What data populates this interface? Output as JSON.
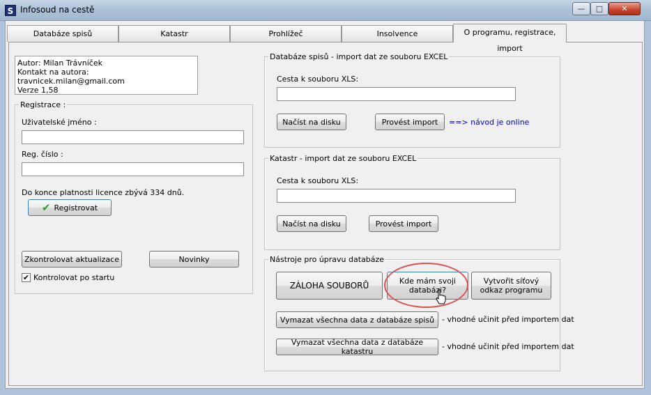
{
  "window": {
    "title": "Infosoud na cestě",
    "app_icon": "S",
    "minimize": "—",
    "maximize": "□",
    "close": "✕"
  },
  "tabs": [
    {
      "label": "Databáze spisů"
    },
    {
      "label": "Katastr"
    },
    {
      "label": "Prohlížeč"
    },
    {
      "label": "Insolvence"
    },
    {
      "label": "O programu, registrace, import"
    }
  ],
  "about": {
    "line1": "Autor: Milan Trávníček",
    "line2": "Kontakt na autora: travnicek.milan@gmail.com",
    "line3": "Verze 1,58"
  },
  "registration": {
    "group_label": "Registrace :",
    "username_label": "Uživatelské jméno :",
    "username_value": "",
    "regnum_label": "Reg. číslo :",
    "regnum_value": "",
    "license_text": "Do konce platnosti licence zbývá 334 dnů.",
    "register_button": "Registrovat",
    "check_updates_button": "Zkontrolovat aktualizace",
    "news_button": "Novinky",
    "check_on_start_label": "Kontrolovat po startu",
    "check_on_start_checked": true,
    "check_mark": "✔"
  },
  "import_spisy": {
    "group_label": "Databáze spisů - import dat ze souboru EXCEL",
    "path_label": "Cesta k souboru XLS:",
    "path_value": "",
    "load_button": "Načíst na disku",
    "import_button": "Provést import",
    "online_link": "==> návod je online"
  },
  "import_katastr": {
    "group_label": "Katastr - import dat ze souboru EXCEL",
    "path_label": "Cesta k souboru XLS:",
    "path_value": "",
    "load_button": "Načíst na disku",
    "import_button": "Provést import"
  },
  "tools": {
    "group_label": "Nástroje pro úpravu databáze",
    "backup_button": "ZÁLOHA SOUBORŮ",
    "where_db_button": "Kde mám svoji databázi?",
    "network_link_button": "Vytvořit síťový odkaz programu",
    "clear_spisy_button": "Vymazat všechna data z databáze spisů",
    "clear_spisy_note": "- vhodné učinit před importem dat",
    "clear_katastr_button": "Vymazat všechna data z databáze katastru",
    "clear_katastr_note": "- vhodné učinit před importem dat"
  },
  "colors": {
    "highlight_ellipse": "#d9534f",
    "link": "#0000cc",
    "checkmark_green": "#2a9d2a"
  }
}
